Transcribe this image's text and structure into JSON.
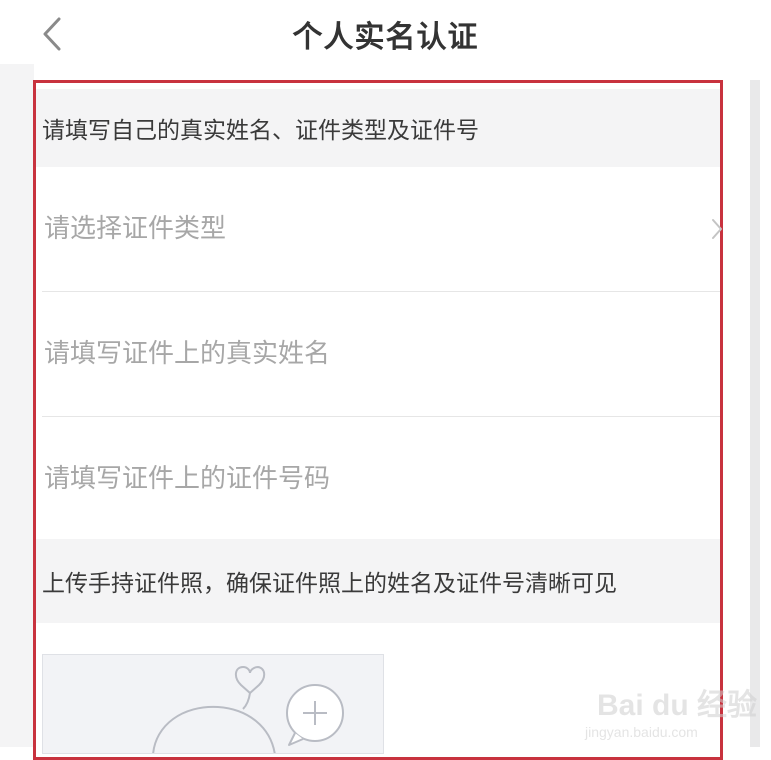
{
  "header": {
    "title": "个人实名认证",
    "back_icon": "chevron-left-icon"
  },
  "notice_top": "请填写自己的真实姓名、证件类型及证件号",
  "form": {
    "id_type": {
      "placeholder": "请选择证件类型",
      "value": "",
      "icon": "chevron-right-icon"
    },
    "real_name": {
      "placeholder": "请填写证件上的真实姓名",
      "value": ""
    },
    "id_number": {
      "placeholder": "请填写证件上的证件号码",
      "value": ""
    }
  },
  "notice_bottom": "上传手持证件照，确保证件照上的姓名及证件号清晰可见",
  "upload": {
    "icon": "add-photo-icon"
  },
  "watermark": {
    "text": "Bai du 经验",
    "sub": "jingyan.baidu.com"
  },
  "colors": {
    "highlight_border": "#c8323e",
    "section_bg": "#f4f4f5",
    "placeholder": "#a7a7a7"
  }
}
